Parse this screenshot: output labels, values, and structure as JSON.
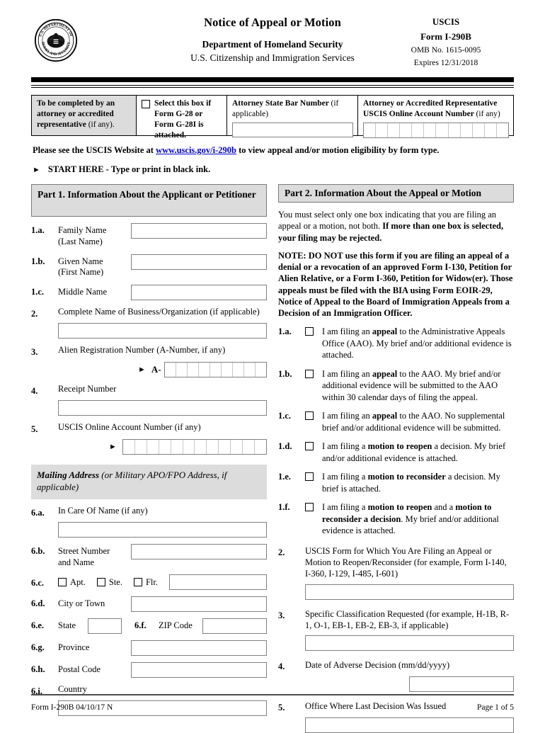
{
  "header": {
    "seal_icon": "dhs-seal-icon",
    "title": "Notice of Appeal or Motion",
    "department": "Department of Homeland Security",
    "agency_full": "U.S. Citizenship and Immigration Services",
    "agency": "USCIS",
    "form_number": "Form I-290B",
    "omb": "OMB No. 1615-0095",
    "expires": "Expires 12/31/2018"
  },
  "attorney": {
    "instruction": "To be completed by an attorney or accredited representative",
    "instruction_suffix": "(if any).",
    "checkbox_label": "Select this box if Form G-28 or Form G-28I is attached.",
    "bar_label": "Attorney State Bar Number",
    "bar_note": "(if applicable)",
    "bar_value": "",
    "account_label": "Attorney or Accredited Representative USCIS Online Account Number",
    "account_note": "(if any)",
    "account_cells": 12
  },
  "notices": {
    "website_prefix": "Please see the USCIS Website at",
    "website_link": "www.uscis.gov/i-290b",
    "website_suffix": "to view appeal and/or motion eligibility by form type.",
    "start_here": "START HERE  -  Type or print in black ink.",
    "arrow_icon": "triangle-right-icon"
  },
  "part1": {
    "heading": "Part 1.  Information About the Applicant or Petitioner",
    "items": [
      {
        "num": "1.a.",
        "label": "Family Name",
        "label2": "(Last Name)",
        "value": ""
      },
      {
        "num": "1.b.",
        "label": "Given Name",
        "label2": "(First Name)",
        "value": ""
      },
      {
        "num": "1.c.",
        "label": "Middle Name",
        "label2": "",
        "value": ""
      }
    ],
    "item2": {
      "num": "2.",
      "label": "Complete Name of Business/Organization (if applicable)",
      "value": ""
    },
    "item3": {
      "num": "3.",
      "label": "Alien Registration Number (A-Number, if any)",
      "prefix": "A-",
      "cells": 9
    },
    "item4": {
      "num": "4.",
      "label": "Receipt Number",
      "value": ""
    },
    "item5": {
      "num": "5.",
      "label": "USCIS Online Account Number (if any)",
      "cells": 12
    },
    "mailing_heading_bold": "Mailing Address",
    "mailing_heading_rest": " (or Military APO/FPO Address, if applicable)",
    "address": {
      "a": {
        "num": "6.a.",
        "label": "In Care Of Name (if any)",
        "value": ""
      },
      "b": {
        "num": "6.b.",
        "label": "Street Number",
        "label2": "and Name",
        "value": ""
      },
      "c": {
        "num": "6.c.",
        "opt1": "Apt.",
        "opt2": "Ste.",
        "opt3": "Flr.",
        "value": ""
      },
      "d": {
        "num": "6.d.",
        "label": "City or Town",
        "value": ""
      },
      "e": {
        "num": "6.e.",
        "label": "State",
        "value": ""
      },
      "f": {
        "num": "6.f.",
        "label": "ZIP Code",
        "value": ""
      },
      "g": {
        "num": "6.g.",
        "label": "Province",
        "value": ""
      },
      "h": {
        "num": "6.h.",
        "label": "Postal Code",
        "value": ""
      },
      "i": {
        "num": "6.i.",
        "label": "Country",
        "value": ""
      }
    }
  },
  "part2": {
    "heading": "Part 2.  Information About the Appeal or Motion",
    "intro_plain": "You must select only one box indicating that you are filing an appeal or a motion, not both.  ",
    "intro_bold": "If more than one box is selected, your filing may be rejected.",
    "note": "NOTE:  DO NOT use this form if you are filing an appeal of a denial or a revocation of an approved Form I-130, Petition for Alien Relative, or a Form I-360, Petition for Widow(er). Those appeals must be filed with the BIA using Form EOIR-29, Notice of Appeal to the Board of Immigration Appeals from a Decision of an Immigration Officer.",
    "options": [
      {
        "num": "1.a.",
        "p1": "I am filing an ",
        "b1": "appeal",
        "p2": " to the Administrative Appeals Office (AAO).  My brief and/or additional evidence is attached.",
        "b2": "",
        "p3": "",
        "checked": false
      },
      {
        "num": "1.b.",
        "p1": "I am filing an ",
        "b1": "appeal",
        "p2": " to the AAO.  My brief and/or additional evidence will be submitted to the AAO within 30 calendar days of filing the appeal.",
        "b2": "",
        "p3": "",
        "checked": false
      },
      {
        "num": "1.c.",
        "p1": "I am filing an ",
        "b1": "appeal",
        "p2": " to the AAO.  No supplemental brief and/or additional evidence will be submitted.",
        "b2": "",
        "p3": "",
        "checked": false
      },
      {
        "num": "1.d.",
        "p1": "I am filing a ",
        "b1": "motion to reopen",
        "p2": " a decision.  My brief and/or additional evidence is attached.",
        "b2": "",
        "p3": "",
        "checked": false
      },
      {
        "num": "1.e.",
        "p1": "I am filing a ",
        "b1": "motion to reconsider",
        "p2": " a decision.  My brief is attached.",
        "b2": "",
        "p3": "",
        "checked": false
      },
      {
        "num": "1.f.",
        "p1": "I am filing a ",
        "b1": "motion to reopen",
        "p2": " and a ",
        "b2": "motion to reconsider a decision",
        "p3": ".  My brief and/or additional evidence is attached.",
        "checked": false
      }
    ],
    "q2": {
      "num": "2.",
      "label": "USCIS Form for Which You Are Filing an Appeal or Motion to Reopen/Reconsider (for example, Form I-140, I-360, I-129, I-485, I-601)",
      "value": ""
    },
    "q3": {
      "num": "3.",
      "label": "Specific Classification Requested (for example, H-1B, R-1, O-1, EB-1, EB-2, EB-3, if applicable)",
      "value": ""
    },
    "q4": {
      "num": "4.",
      "label": "Date of Adverse Decision (mm/dd/yyyy)",
      "value": ""
    },
    "q5": {
      "num": "5.",
      "label": "Office Where Last Decision Was Issued",
      "value": ""
    }
  },
  "footer": {
    "left": "Form I-290B   04/10/17   N",
    "right": "Page 1 of 5"
  }
}
